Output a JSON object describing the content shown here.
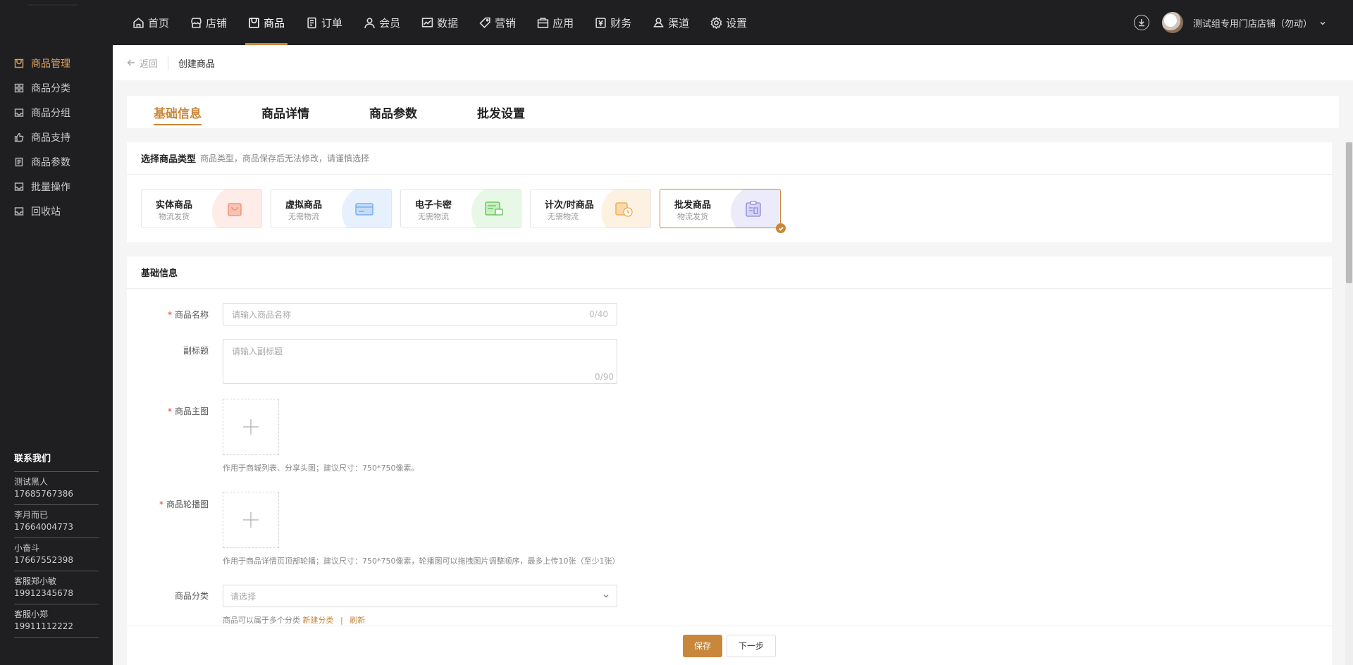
{
  "nav": {
    "items": [
      {
        "label": "首页",
        "icon": "home-icon"
      },
      {
        "label": "店铺",
        "icon": "store-icon"
      },
      {
        "label": "商品",
        "icon": "goods-icon"
      },
      {
        "label": "订单",
        "icon": "order-icon"
      },
      {
        "label": "会员",
        "icon": "member-icon"
      },
      {
        "label": "数据",
        "icon": "data-icon"
      },
      {
        "label": "营销",
        "icon": "tag-icon"
      },
      {
        "label": "应用",
        "icon": "app-icon"
      },
      {
        "label": "财务",
        "icon": "finance-icon"
      },
      {
        "label": "渠道",
        "icon": "channel-icon"
      },
      {
        "label": "设置",
        "icon": "gear-icon"
      }
    ],
    "active": "商品",
    "store_name": "测试组专用门店店铺（勿动）"
  },
  "sidebar": {
    "items": [
      {
        "label": "商品管理"
      },
      {
        "label": "商品分类"
      },
      {
        "label": "商品分组"
      },
      {
        "label": "商品支持"
      },
      {
        "label": "商品参数"
      },
      {
        "label": "批量操作"
      },
      {
        "label": "回收站"
      }
    ],
    "contact_title": "联系我们",
    "contacts": [
      {
        "name": "测试黑人",
        "phone": "17685767386"
      },
      {
        "name": "李月而已",
        "phone": "17664004773"
      },
      {
        "name": "小奋斗",
        "phone": "17667552398"
      },
      {
        "name": "客服郑小敏",
        "phone": "19912345678"
      },
      {
        "name": "客服小郑",
        "phone": "19911112222"
      }
    ]
  },
  "breadcrumb": {
    "back": "返回",
    "current": "创建商品"
  },
  "tabs": [
    {
      "label": "基础信息"
    },
    {
      "label": "商品详情"
    },
    {
      "label": "商品参数"
    },
    {
      "label": "批发设置"
    }
  ],
  "type_section": {
    "title": "选择商品类型",
    "hint": "商品类型，商品保存后无法修改，请谨慎选择",
    "types": [
      {
        "name": "实体商品",
        "desc": "物流发货",
        "color": "#fdece7"
      },
      {
        "name": "虚拟商品",
        "desc": "无需物流",
        "color": "#e6f1fd"
      },
      {
        "name": "电子卡密",
        "desc": "无需物流",
        "color": "#e8f8e6"
      },
      {
        "name": "计次/时商品",
        "desc": "无需物流",
        "color": "#fdf1e2"
      },
      {
        "name": "批发商品",
        "desc": "物流发货",
        "color": "#ecebfa"
      }
    ],
    "selected": "批发商品"
  },
  "basic": {
    "title": "基础信息",
    "name_label": "商品名称",
    "name_placeholder": "请输入商品名称",
    "name_count": "0/40",
    "subtitle_label": "副标题",
    "subtitle_placeholder": "请输入副标题",
    "subtitle_count": "0/90",
    "main_img_label": "商品主图",
    "main_img_help": "作用于商城列表、分享头图；建议尺寸：750*750像素。",
    "carousel_label": "商品轮播图",
    "carousel_help": "作用于商品详情页顶部轮播；建议尺寸：750*750像素，轮播图可以拖拽图片调整顺序，最多上传10张（至少1张）",
    "category_label": "商品分类",
    "category_placeholder": "请选择",
    "category_help": "商品可以属于多个分类",
    "new_category": "新建分类",
    "separator": "|",
    "refresh": "刷新"
  },
  "footer": {
    "save": "保存",
    "next": "下一步"
  },
  "colors": {
    "accent": "#c8873a",
    "dark": "#1f1f21"
  }
}
